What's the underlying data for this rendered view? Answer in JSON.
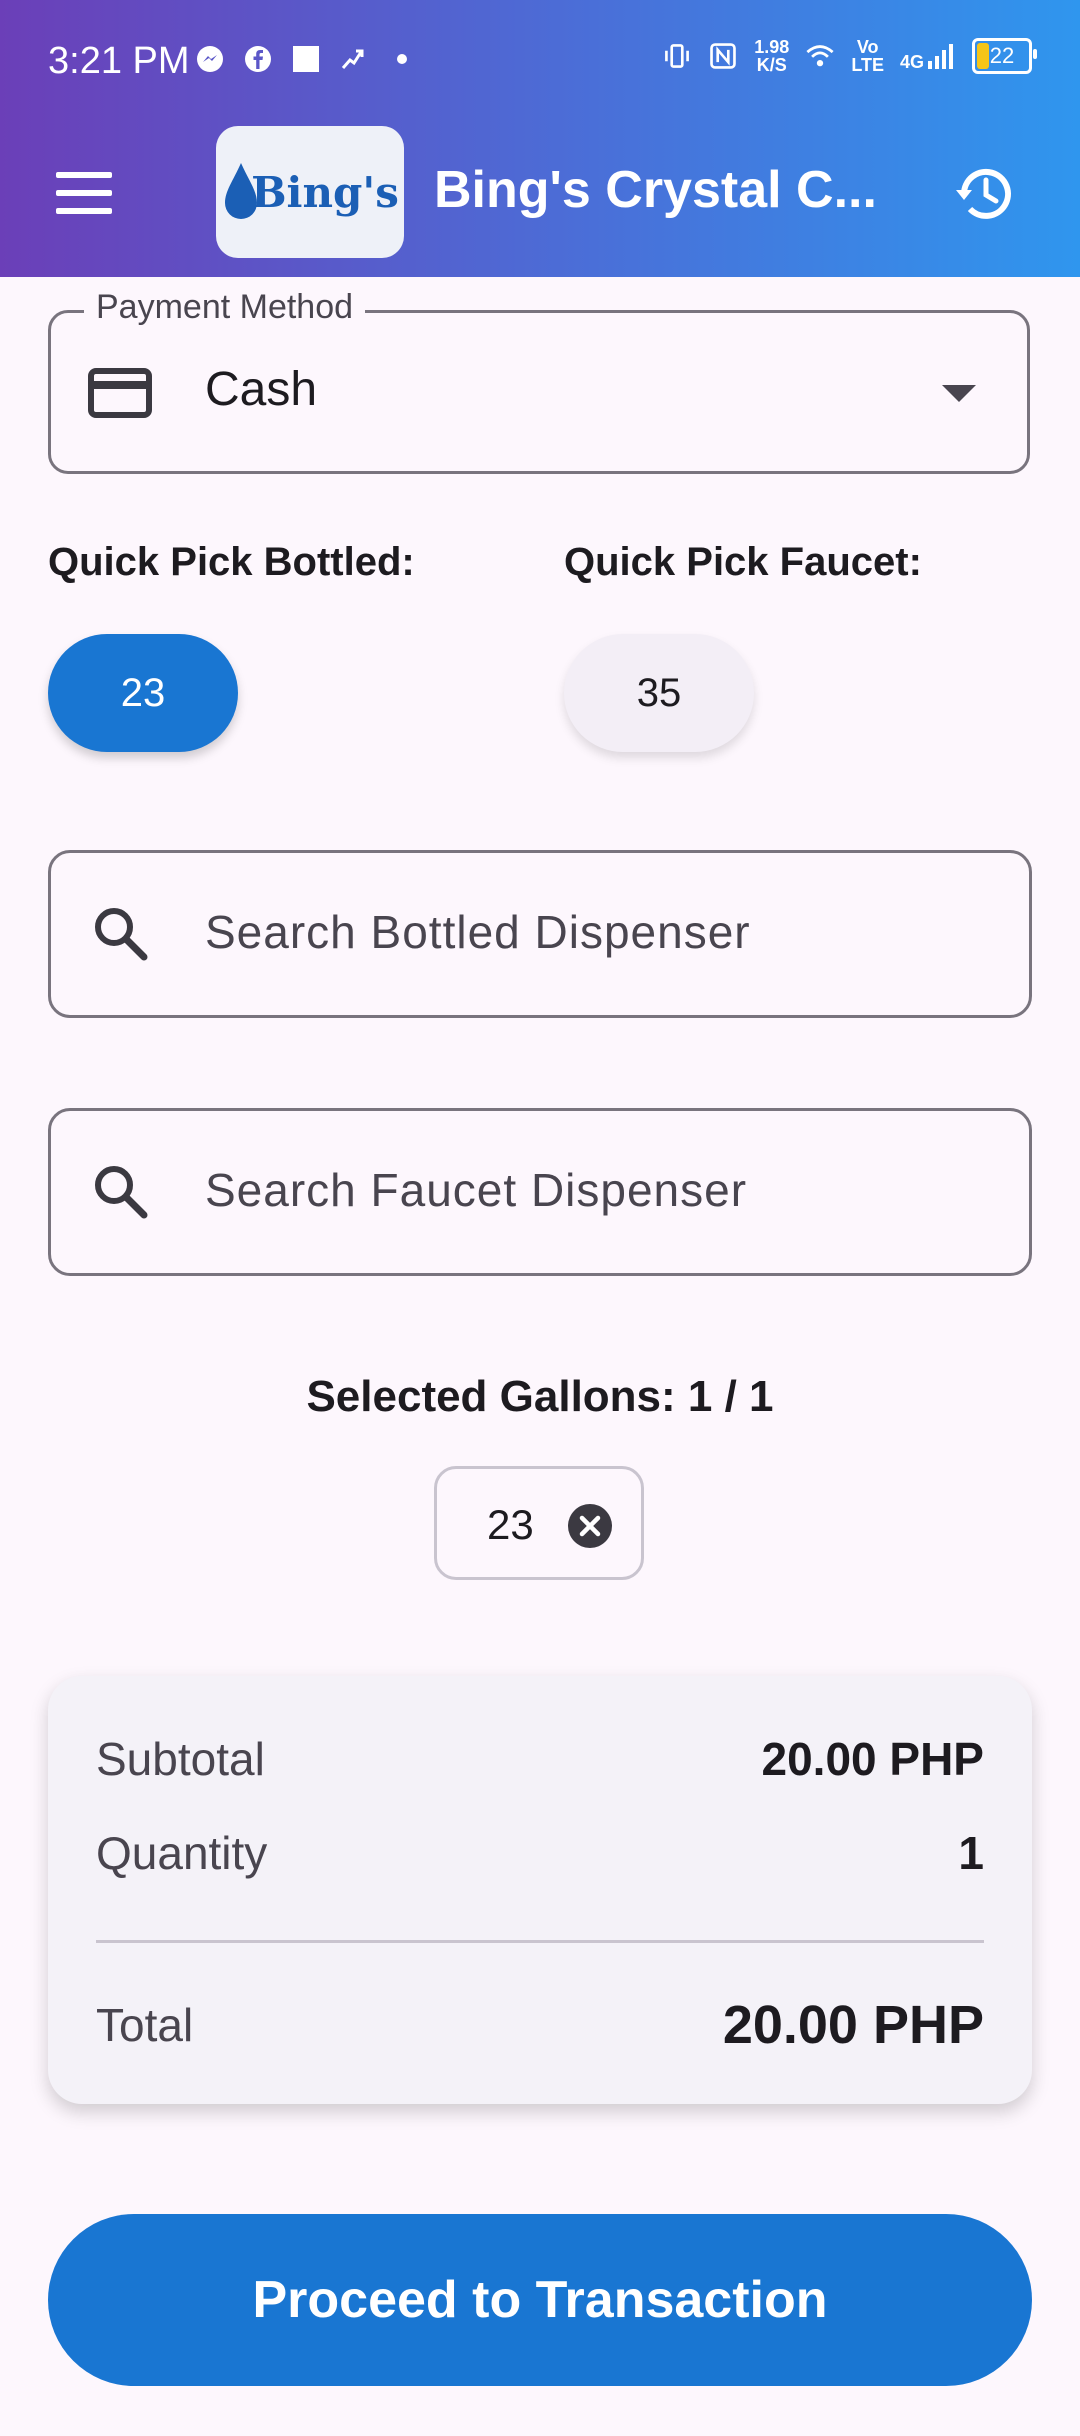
{
  "status_bar": {
    "time": "3:21 PM",
    "net_speed_value": "1.98",
    "net_speed_unit": "K/S",
    "volte_top": "Vo",
    "volte_bottom": "LTE",
    "network": "4G",
    "battery": "22",
    "left_icons": [
      "messenger-icon",
      "facebook-icon",
      "square-icon",
      "activity-icon",
      "dot-icon"
    ],
    "right_icons": [
      "vibrate-icon",
      "nfc-icon",
      "wifi-icon",
      "signal-icon",
      "battery-icon"
    ]
  },
  "app_bar": {
    "logo_text": "Bing's",
    "title": "Bing's Crystal C...",
    "menu_icon": "menu-icon",
    "history_icon": "history-icon"
  },
  "payment": {
    "label": "Payment Method",
    "value": "Cash",
    "icon": "credit-card-icon"
  },
  "quick_pick": {
    "bottled_label": "Quick Pick Bottled:",
    "faucet_label": "Quick Pick Faucet:",
    "bottled_chip": "23",
    "faucet_chip": "35"
  },
  "search": {
    "bottled_placeholder": "Search Bottled Dispenser",
    "faucet_placeholder": "Search Faucet Dispenser"
  },
  "selected": {
    "title": "Selected Gallons: 1 / 1",
    "chips": [
      "23"
    ]
  },
  "summary": {
    "subtotal_label": "Subtotal",
    "subtotal_value": "20.00 PHP",
    "quantity_label": "Quantity",
    "quantity_value": "1",
    "total_label": "Total",
    "total_value": "20.00 PHP"
  },
  "actions": {
    "proceed_label": "Proceed to Transaction"
  },
  "colors": {
    "primary": "#1976d2",
    "header_gradient_start": "#6b3fb8",
    "header_gradient_end": "#2f96ee",
    "background": "#fdf7fd"
  }
}
